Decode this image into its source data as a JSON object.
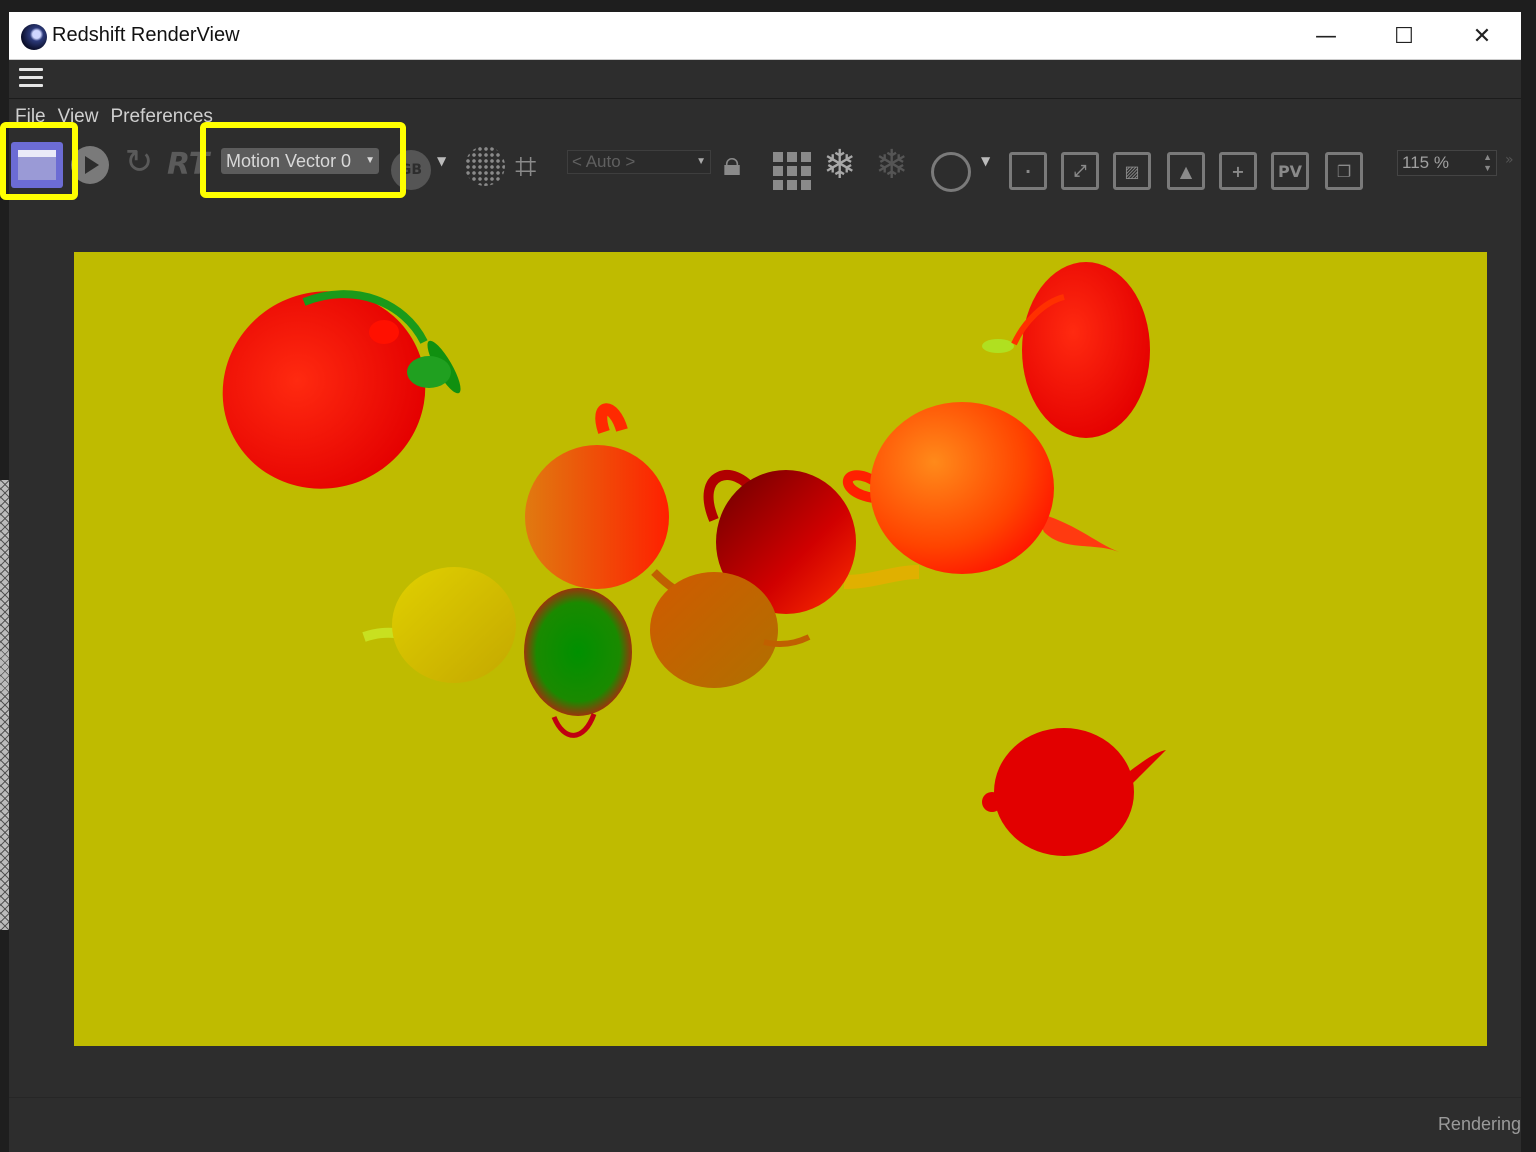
{
  "window": {
    "title": "Redshift RenderView",
    "controls": {
      "minimize": "—",
      "maximize": "☐",
      "close": "✕"
    }
  },
  "menu": {
    "items": [
      "File",
      "View",
      "Preferences"
    ]
  },
  "toolbar": {
    "rt_label": "RT",
    "aov_select": "Motion Vector 0",
    "rgb_label": "GB",
    "bucket_select": "< Auto >",
    "pv_label": "PV",
    "zoom_value": "115 %",
    "icons": [
      "render-clapper-icon",
      "play-icon",
      "refresh-icon",
      "rgb-icon",
      "dots-grid-icon",
      "crop-icon",
      "lock-icon",
      "grid-icon",
      "freeze-icon",
      "freeze-geometry-icon",
      "circle-icon",
      "focus-icon",
      "fit-icon",
      "hatch-icon",
      "image-icon",
      "add-snapshot-icon",
      "pv-icon",
      "copy-icon"
    ]
  },
  "highlight_color": "#ffff00",
  "viewport": {
    "background": "#bfbb00"
  },
  "status": {
    "text": "Rendering"
  }
}
